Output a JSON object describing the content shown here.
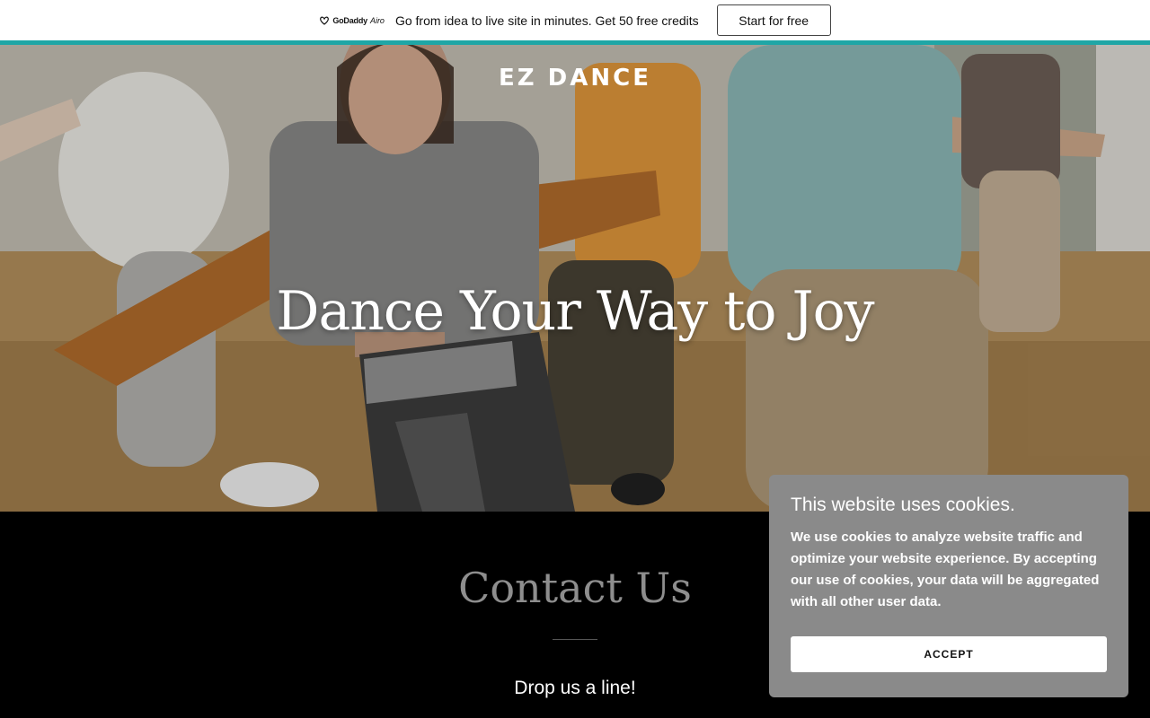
{
  "promo": {
    "brand_text": "GoDaddy",
    "brand_sub": "Airo",
    "message": "Go from idea to live site in minutes. Get 50 free credits",
    "cta_label": "Start for free",
    "accent_color": "#1fa6a6"
  },
  "hero": {
    "site_title": "EZ DANCE",
    "heading": "Dance Your Way to Joy"
  },
  "contact": {
    "title": "Contact Us",
    "subtitle": "Drop us a line!"
  },
  "cookie": {
    "title": "This website uses cookies.",
    "body": "We use cookies to analyze website traffic and optimize your website experience. By accepting our use of cookies, your data will be aggregated with all other user data.",
    "accept_label": "ACCEPT"
  }
}
